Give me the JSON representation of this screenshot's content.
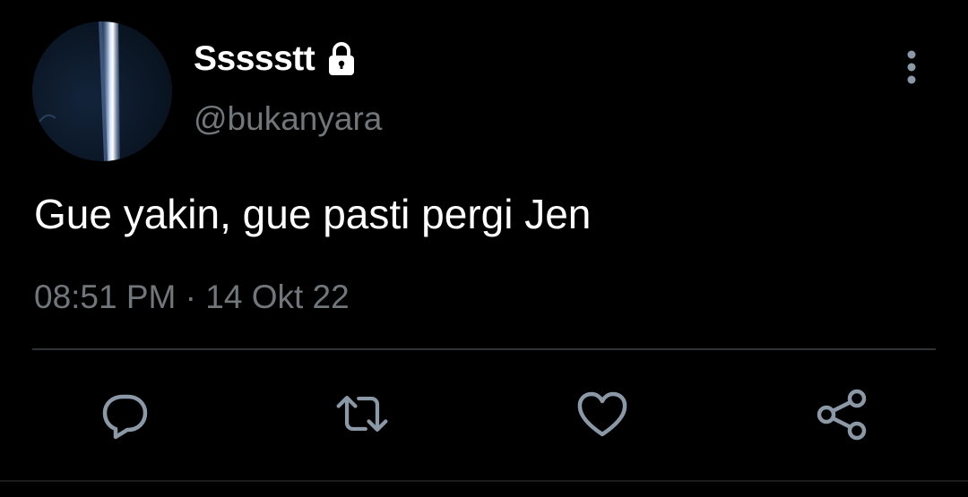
{
  "tweet": {
    "display_name": "Ssssstt",
    "handle": "@bukanyara",
    "text": "Gue yakin, gue pasti pergi Jen",
    "time": "08:51 PM",
    "separator": "·",
    "date": "14 Okt 22",
    "protected_icon": "lock-icon"
  },
  "actions": [
    {
      "name": "reply",
      "icon": "speech-bubble-icon"
    },
    {
      "name": "retweet",
      "icon": "retweet-icon"
    },
    {
      "name": "like",
      "icon": "heart-icon"
    },
    {
      "name": "share",
      "icon": "share-icon"
    }
  ],
  "menu": {
    "icon": "more-vertical-icon"
  },
  "colors": {
    "background": "#000000",
    "primary_text": "#ffffff",
    "secondary_text": "#71767b",
    "icon": "#8b98a5",
    "divider": "#2f3336"
  }
}
